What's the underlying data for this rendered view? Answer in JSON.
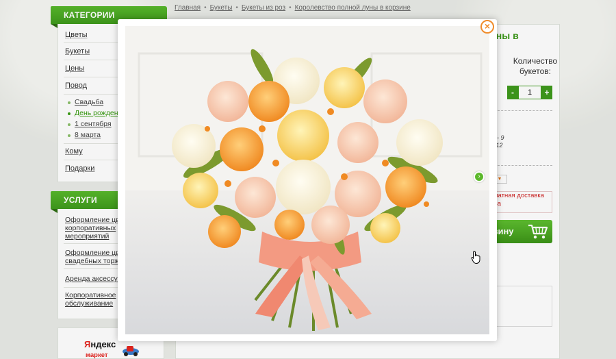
{
  "categories": {
    "heading": "КАТЕГОРИИ",
    "items": [
      "Цветы",
      "Букеты",
      "Цены",
      "Повод",
      "Кому",
      "Подарки"
    ],
    "occasions": [
      "Свадьба",
      "День рождения",
      "1 сентября",
      "8 марта"
    ]
  },
  "services": {
    "heading": "УСЛУГИ",
    "items": [
      "Оформление цветами корпоративных мероприятий",
      "Оформление цветами свадебных торжеств",
      "Аренда аксессуаров",
      "Корпоративное обслуживание"
    ]
  },
  "breadcrumb": [
    "Главная",
    "Букеты",
    "Букеты из роз",
    "Королевство полной луны в корзине"
  ],
  "product": {
    "title_partial": "уны в",
    "qty_label": "Количество букетов:",
    "qty_minus": "-",
    "qty_value": "1",
    "qty_plus": "+",
    "delivery_line1": "с - 9",
    "delivery_line2": "- 12",
    "select_arrow": "▼",
    "promo_partial": "латная доставка",
    "promo_partial2": "са",
    "cart_label_partial": "зину"
  },
  "lightbox": {
    "close_glyph": "×",
    "next_glyph": "›"
  },
  "yandex": {
    "logo_main": "ндекс",
    "logo_letter": "Я",
    "market": "маркет"
  },
  "colors": {
    "brand_green": "#3f9a1d",
    "accent_orange": "#f08c2b",
    "promo_red": "#d02020"
  }
}
